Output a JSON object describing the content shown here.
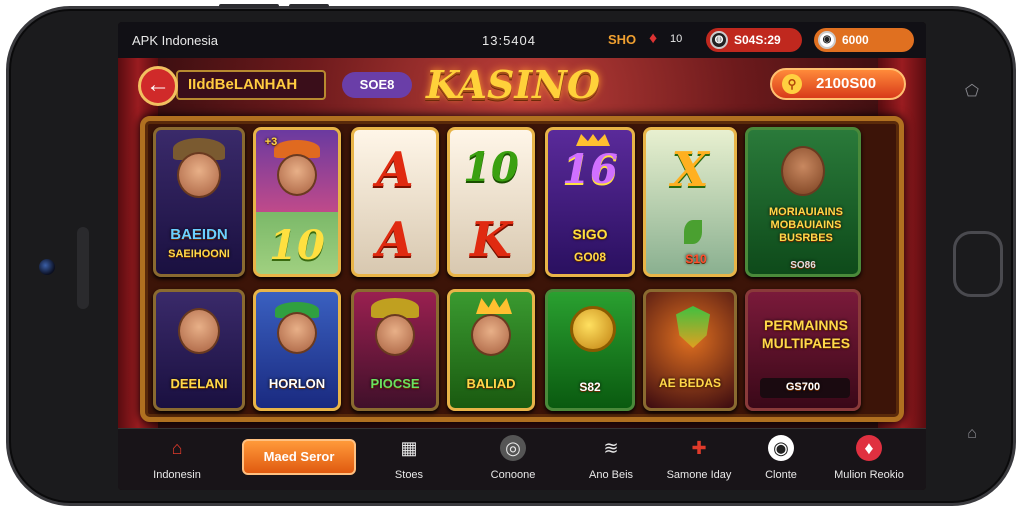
{
  "status_bar": {
    "app_name": "APK Indonesia",
    "clock": "13:5404",
    "shp_label": "SHO",
    "gem_count": "10",
    "balance_1": "S04S:29",
    "balance_2": "6000"
  },
  "header": {
    "back_symbol": "←",
    "title": "IIddBeLANHAH",
    "purple_tag": "SOE8",
    "logo": "KASINO",
    "coins": "2100S00"
  },
  "tiles": {
    "t1": {
      "label_1": "BAEIDN",
      "label_2": "SAEIHOONI"
    },
    "t2": {
      "big": "10",
      "corner": "+3"
    },
    "t3": {
      "top": "A",
      "bottom": "A"
    },
    "t4": {
      "top": "10",
      "bottom": "K"
    },
    "t5": {
      "top": "16",
      "mid": "SIGO",
      "bottom": "GO08"
    },
    "t6": {
      "top": "X",
      "bottom": "S10"
    },
    "t7": {
      "text": "MORIAUIAINS MOBAUIAINS BUSRBES",
      "value": "SO86"
    },
    "t8": {
      "label": "DEELANI"
    },
    "t9": {
      "label": "HORLON"
    },
    "t10": {
      "label": "PIOCSE"
    },
    "t11": {
      "label": "BALIAD"
    },
    "t12": {
      "value": "S82"
    },
    "t13": {
      "label": "AE BEDAS"
    },
    "t14": {
      "text": "PERMAINNS MULTIPAEES",
      "value": "GS700"
    }
  },
  "nav": {
    "items": [
      {
        "icon": "⌂",
        "label": "Indonesin"
      },
      {
        "icon": "▦",
        "label": "Stoes"
      },
      {
        "icon": "◎",
        "label": "Conoone"
      },
      {
        "icon": "≋",
        "label": "Ano Beis"
      },
      {
        "icon": "✚",
        "label": "Samone Iday"
      },
      {
        "icon": "◉",
        "label": "Clonte"
      },
      {
        "icon": "♦",
        "label": "Mulion Reokio"
      }
    ],
    "orange_button": "Maed Seror"
  },
  "colors": {
    "accent_orange": "#e05a10",
    "brand_gold": "#ffd13a",
    "frame_gold": "#b07020"
  }
}
